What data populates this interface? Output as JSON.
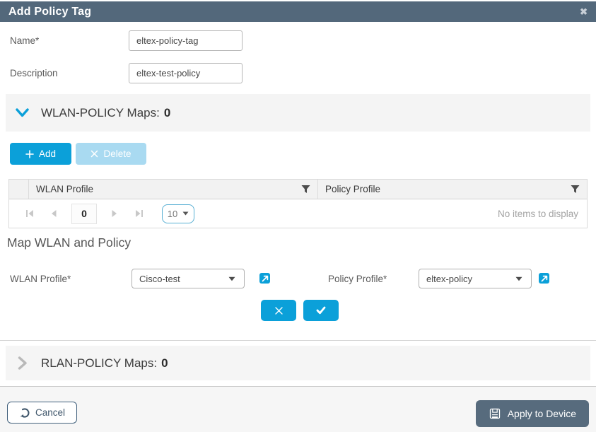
{
  "dialog": {
    "title": "Add Policy Tag",
    "close_glyph": "✖"
  },
  "form": {
    "name": {
      "label": "Name*",
      "value": "eltex-policy-tag"
    },
    "description": {
      "label": "Description",
      "value": "eltex-test-policy"
    }
  },
  "wlan_section": {
    "title": "WLAN-POLICY Maps:",
    "count": "0",
    "add_button": "Add",
    "delete_button": "Delete",
    "table": {
      "columns": [
        {
          "label": "WLAN Profile"
        },
        {
          "label": "Policy Profile"
        }
      ],
      "pager": {
        "current_page": "0",
        "page_size": "10",
        "empty_message": "No items to display"
      }
    }
  },
  "map_section": {
    "title": "Map WLAN and Policy",
    "wlan_profile": {
      "label": "WLAN Profile*",
      "value": "Cisco-test"
    },
    "policy_profile": {
      "label": "Policy Profile*",
      "value": "eltex-policy"
    }
  },
  "rlan_section": {
    "title": "RLAN-POLICY Maps:",
    "count": "0"
  },
  "footer": {
    "cancel_label": "Cancel",
    "apply_label": "Apply to Device"
  },
  "colors": {
    "header_bg": "#53687b",
    "accent_cyan": "#0ba0d9",
    "disabled_button": "#a9daf1",
    "band_bg": "#f4f4f4",
    "apply_button_bg": "#576b7d",
    "footer_bg": "#f6f6f6"
  }
}
